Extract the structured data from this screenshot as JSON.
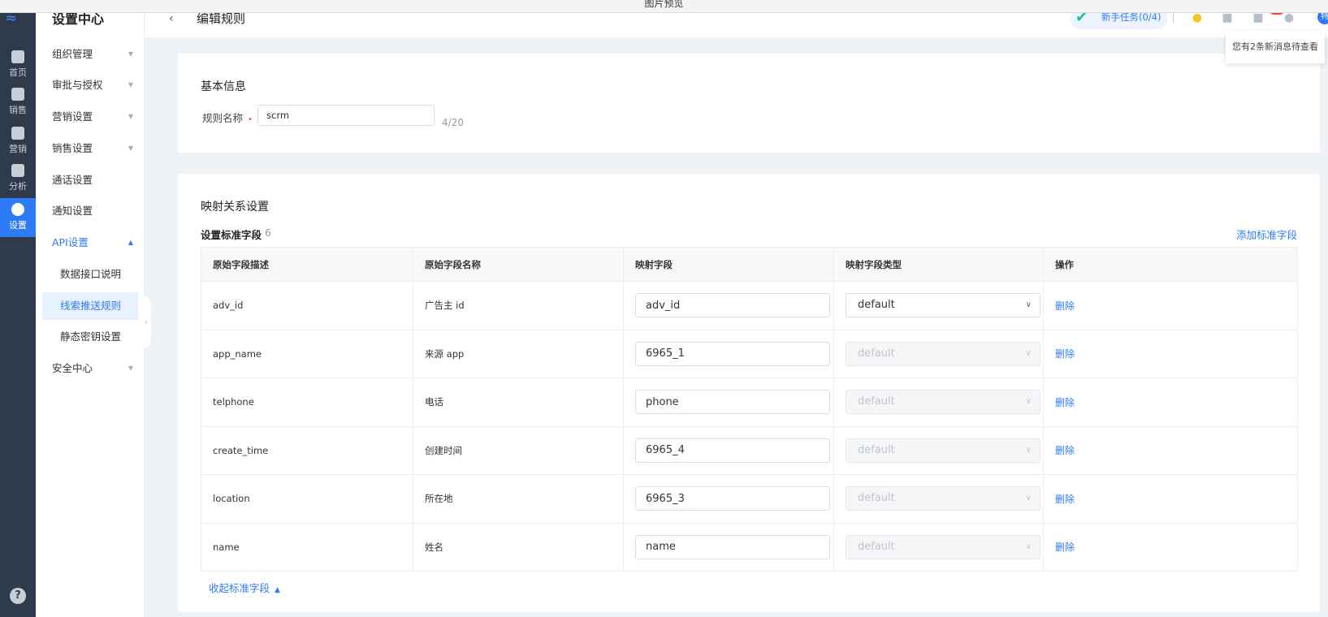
{
  "window_title": "图片预览",
  "rail": {
    "items": [
      {
        "label": "首页",
        "icon": "home-icon"
      },
      {
        "label": "销售",
        "icon": "phone-icon"
      },
      {
        "label": "营销",
        "icon": "edit-icon"
      },
      {
        "label": "分析",
        "icon": "chart-icon"
      },
      {
        "label": "设置",
        "icon": "settings-icon",
        "active": true
      }
    ],
    "help": "?"
  },
  "submenu": {
    "title": "设置中心",
    "items": [
      {
        "label": "组织管理"
      },
      {
        "label": "审批与授权"
      },
      {
        "label": "营销设置"
      },
      {
        "label": "销售设置"
      },
      {
        "label": "通话设置"
      },
      {
        "label": "通知设置"
      },
      {
        "label": "API设置"
      },
      {
        "label": "数据接口说明"
      },
      {
        "label": "线索推送规则"
      },
      {
        "label": "静态密钥设置"
      },
      {
        "label": "安全中心"
      }
    ]
  },
  "header": {
    "back": "‹",
    "title": "编辑规则",
    "task": "新手任务(0/4)",
    "avatar": "特",
    "notice": "您有2条新消息待查看"
  },
  "basic": {
    "title": "基本信息",
    "name_label": "规则名称",
    "required_mark": "•",
    "name_value": "scrm",
    "name_count": "4/20"
  },
  "mapping": {
    "title": "映射关系设置",
    "std_label": "设置标准字段",
    "std_count": "6",
    "add_label": "添加标准字段",
    "columns": [
      "原始字段描述",
      "原始字段名称",
      "映射字段",
      "映射字段类型",
      "操作"
    ],
    "rows": [
      {
        "desc": "adv_id",
        "name": "广告主 id",
        "field": "adv_id",
        "type": "default",
        "action": "删除"
      },
      {
        "desc": "app_name",
        "name": "来源 app",
        "field": "6965_1",
        "type": "default",
        "action": "删除"
      },
      {
        "desc": "telphone",
        "name": "电话",
        "field": "phone",
        "type": "default",
        "action": "删除"
      },
      {
        "desc": "create_time",
        "name": "创建时间",
        "field": "6965_4",
        "type": "default",
        "action": "删除"
      },
      {
        "desc": "location",
        "name": "所在地",
        "field": "6965_3",
        "type": "default",
        "action": "删除"
      },
      {
        "desc": "name",
        "name": "姓名",
        "field": "name",
        "type": "default",
        "action": "删除"
      }
    ],
    "collapse_label": "收起标准字段"
  },
  "colors": {
    "accent": "#2f7bf5",
    "rail_bg": "#2f3a4b",
    "danger": "#f5473b"
  }
}
